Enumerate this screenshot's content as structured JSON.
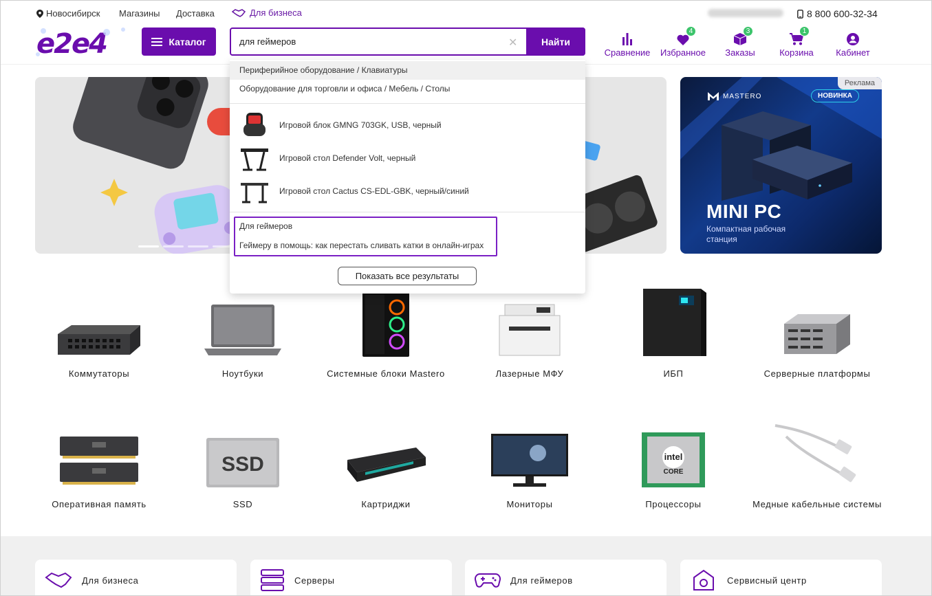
{
  "topbar": {
    "city": "Новосибирск",
    "stores": "Магазины",
    "delivery": "Доставка",
    "business": "Для бизнеса",
    "phone": "8 800 600-32-34"
  },
  "header": {
    "catalog_label": "Каталог",
    "search_value": "для геймеров",
    "search_button": "Найти",
    "nav": [
      {
        "label": "Сравнение",
        "icon": "compare-icon",
        "badge": ""
      },
      {
        "label": "Избранное",
        "icon": "heart-icon",
        "badge": "4"
      },
      {
        "label": "Заказы",
        "icon": "box-icon",
        "badge": "3"
      },
      {
        "label": "Корзина",
        "icon": "cart-icon",
        "badge": "1"
      },
      {
        "label": "Кабинет",
        "icon": "user-icon",
        "badge": ""
      }
    ]
  },
  "dropdown": {
    "categories": [
      "Периферийное оборудование / Клавиатуры",
      "Оборудование для торговли и офиса / Мебель / Столы"
    ],
    "products": [
      "Игровой блок GMNG 703GK, USB, черный",
      "Игровой стол Defender Volt, черный",
      "Игровой стол Cactus CS-EDL-GBK, черный/синий"
    ],
    "articles": [
      "Для геймеров",
      "Геймеру в помощь: как перестать сливать катки в онлайн-играх"
    ],
    "show_all": "Показать все результаты"
  },
  "ad": {
    "tag": "Реклама",
    "brand": "MASTERO",
    "badge": "НОВИНКА",
    "title": "MINI PC",
    "subtitle": "Компактная рабочая станция"
  },
  "categories": [
    {
      "name": "Коммутаторы",
      "icon": "switch-icon"
    },
    {
      "name": "Ноутбуки",
      "icon": "laptop-icon"
    },
    {
      "name": "Системные блоки Mastero",
      "icon": "pc-case-icon"
    },
    {
      "name": "Лазерные МФУ",
      "icon": "printer-icon"
    },
    {
      "name": "ИБП",
      "icon": "ups-icon"
    },
    {
      "name": "Серверные платформы",
      "icon": "server-icon"
    },
    {
      "name": "Оперативная память",
      "icon": "ram-icon"
    },
    {
      "name": "SSD",
      "icon": "ssd-icon"
    },
    {
      "name": "Картриджи",
      "icon": "cartridge-icon"
    },
    {
      "name": "Мониторы",
      "icon": "monitor-icon"
    },
    {
      "name": "Процессоры",
      "icon": "cpu-icon"
    },
    {
      "name": "Медные кабельные системы",
      "icon": "cable-icon"
    }
  ],
  "bottom_cards": [
    {
      "label": "Для бизнеса",
      "icon": "handshake-icon"
    },
    {
      "label": "Серверы",
      "icon": "servers-icon"
    },
    {
      "label": "Для геймеров",
      "icon": "gamepad-icon"
    },
    {
      "label": "Сервисный центр",
      "icon": "service-icon"
    }
  ],
  "ssd_text": "SSD",
  "cpu_brand": "intel",
  "cpu_line": "CORE",
  "colors": {
    "accent": "#6a0dad",
    "badge": "#3cc46b"
  }
}
